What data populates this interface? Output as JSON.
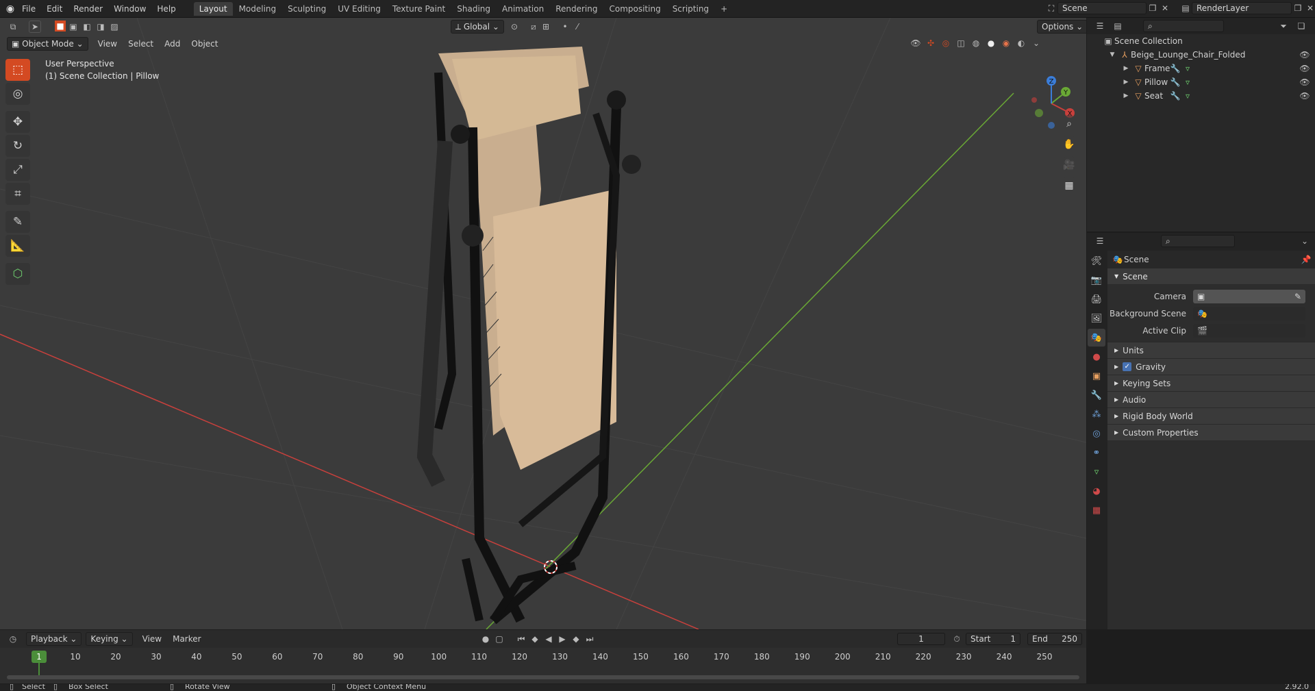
{
  "topbar": {
    "menus": [
      "File",
      "Edit",
      "Render",
      "Window",
      "Help"
    ],
    "workspaces": [
      "Layout",
      "Modeling",
      "Sculpting",
      "UV Editing",
      "Texture Paint",
      "Shading",
      "Animation",
      "Rendering",
      "Compositing",
      "Scripting"
    ],
    "active_workspace": "Layout",
    "add_tab": "+",
    "scene_name": "Scene",
    "view_layer": "RenderLayer"
  },
  "viewport": {
    "mode": "Object Mode",
    "menus": [
      "View",
      "Select",
      "Add",
      "Object"
    ],
    "orientation": "Global",
    "options_label": "Options",
    "overlay_text_1": "User Perspective",
    "overlay_text_2": "(1) Scene Collection | Pillow",
    "axis_labels": {
      "x": "X",
      "y": "Y",
      "z": "Z"
    },
    "colors": {
      "x_axis": "#c8403c",
      "y_axis": "#6aa935",
      "background": "#3b3b3b",
      "active_tool": "#d44a22"
    }
  },
  "outliner": {
    "root": "Scene Collection",
    "collection": "Beige_Lounge_Chair_Folded",
    "objects": [
      "Frame",
      "Pillow",
      "Seat"
    ]
  },
  "properties": {
    "context": "Scene",
    "panel_title": "Scene",
    "camera_label": "Camera",
    "background_scene_label": "Background Scene",
    "active_clip_label": "Active Clip",
    "subpanels": [
      "Units",
      "Gravity",
      "Keying Sets",
      "Audio",
      "Rigid Body World",
      "Custom Properties"
    ],
    "gravity_checked": true
  },
  "timeline": {
    "menus": [
      "Playback",
      "Keying",
      "View",
      "Marker"
    ],
    "current_frame": "1",
    "start_label": "Start",
    "start": "1",
    "end_label": "End",
    "end": "250",
    "ticks": [
      "1",
      "10",
      "20",
      "30",
      "40",
      "50",
      "60",
      "70",
      "80",
      "90",
      "100",
      "110",
      "120",
      "130",
      "140",
      "150",
      "160",
      "170",
      "180",
      "190",
      "200",
      "210",
      "220",
      "230",
      "240",
      "250"
    ]
  },
  "statusbar": {
    "select": "Select",
    "box_select": "Box Select",
    "rotate_view": "Rotate View",
    "context_menu": "Object Context Menu",
    "version": "2.92.0"
  }
}
